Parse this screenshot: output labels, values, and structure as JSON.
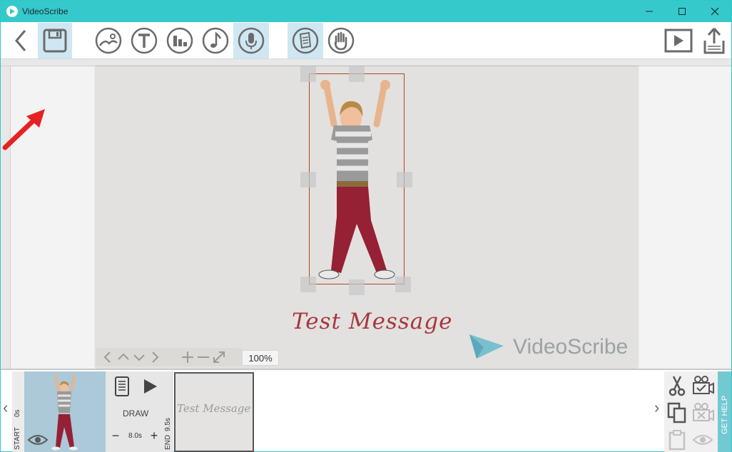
{
  "window": {
    "title": "VideoScribe",
    "minimize_label": "─",
    "maximize_label": "☐",
    "close_label": "✕"
  },
  "toolbar": {
    "back_icon": "chevron-left-icon",
    "save_icon": "save-icon",
    "image_icon": "image-icon",
    "text_icon": "text-icon",
    "chart_icon": "chart-icon",
    "music_icon": "music-icon",
    "voiceover_icon": "microphone-icon",
    "background_icon": "document-icon",
    "hand_icon": "hand-icon",
    "play_icon": "play-icon",
    "share_icon": "share-icon"
  },
  "canvas": {
    "text": "Test Message",
    "logo_text": "VideoScribe",
    "zoom": "100%",
    "accent_color": "#a7373d"
  },
  "timeline": {
    "start_label": "START",
    "start_time": "0s",
    "draw_label": "DRAW",
    "duration": "8.0s",
    "end_label": "END",
    "end_time": "9.5s",
    "element2_text": "Test Message",
    "minus_label": "−",
    "plus_label": "+",
    "get_help": "GET HELP"
  }
}
